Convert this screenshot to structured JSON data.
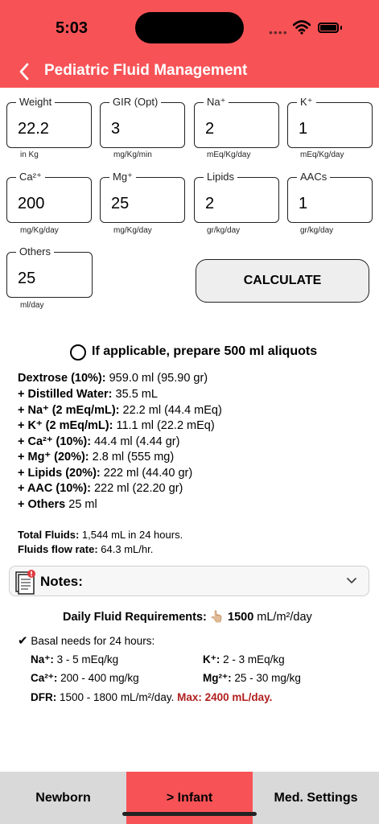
{
  "status": {
    "time": "5:03"
  },
  "header": {
    "title": "Pediatric Fluid Management"
  },
  "inputs": [
    {
      "label": "Weight",
      "value": "22.2",
      "unit": "in Kg"
    },
    {
      "label": "GIR (Opt)",
      "value": "3",
      "unit": "mg/Kg/min"
    },
    {
      "label": "Na⁺",
      "value": "2",
      "unit": "mEq/Kg/day"
    },
    {
      "label": "K⁺",
      "value": "1",
      "unit": "mEq/Kg/day"
    },
    {
      "label": "Ca²⁺",
      "value": "200",
      "unit": "mg/Kg/day"
    },
    {
      "label": "Mg⁺",
      "value": "25",
      "unit": "mg/Kg/day"
    },
    {
      "label": "Lipids",
      "value": "2",
      "unit": "gr/kg/day"
    },
    {
      "label": "AACs",
      "value": "1",
      "unit": "gr/kg/day"
    },
    {
      "label": "Others",
      "value": "25",
      "unit": "ml/day"
    }
  ],
  "calculate_label": "CALCULATE",
  "aliquot_label": "If applicable, prepare 500 ml aliquots",
  "results": [
    {
      "name": "Dextrose (10%):",
      "value": " 959.0 ml (95.90 gr)"
    },
    {
      "name": "+ Distilled Water:",
      "value": " 35.5 mL"
    },
    {
      "name": "+ Na⁺ (2 mEq/mL):",
      "value": " 22.2 ml (44.4 mEq)"
    },
    {
      "name": "+ K⁺ (2 mEq/mL):",
      "value": " 11.1 ml (22.2 mEq)"
    },
    {
      "name": "+ Ca²⁺ (10%):",
      "value": " 44.4 ml (4.44 gr)"
    },
    {
      "name": "+ Mg⁺ (20%):",
      "value": " 2.8 ml (555 mg)"
    },
    {
      "name": "+ Lipids (20%):",
      "value": " 222 ml (44.40 gr)"
    },
    {
      "name": "+ AAC (10%):",
      "value": " 222 ml (22.20 gr)"
    },
    {
      "name": "+ Others",
      "value": " 25 ml"
    }
  ],
  "totals": [
    {
      "name": "Total Fluids:",
      "value": " 1,544 mL in 24 hours."
    },
    {
      "name": "Fluids flow rate:",
      "value": " 64.3 mL/hr."
    }
  ],
  "notes": {
    "title": "Notes:",
    "daily_label": "Daily Fluid Requirements:",
    "hand_emoji": "👆🏼",
    "daily_value": "1500",
    "daily_unit": " mL/m²/day",
    "basal_label": "Basal needs for 24 hours:",
    "na_label": "Na⁺:",
    "na_value": " 3 - 5 mEq/kg",
    "k_label": "K⁺:",
    "k_value": " 2 - 3 mEq/kg",
    "ca_label": "Ca²⁺:",
    "ca_value": " 200 - 400 mg/kg",
    "mg_label": "Mg²⁺:",
    "mg_value": " 25 - 30 mg/kg",
    "dfr_label": "DFR:",
    "dfr_value": " 1500 - 1800 mL/m²/day. ",
    "dfr_max": "Max: 2400 mL/day."
  },
  "tabs": [
    {
      "label": "Newborn"
    },
    {
      "label": "> Infant"
    },
    {
      "label": "Med. Settings"
    }
  ],
  "colors": {
    "accent": "#f75357",
    "warning": "#b01e1e",
    "tabbar": "#d9d9d9"
  },
  "icons": [
    "back-chevron-icon",
    "wifi-icon",
    "battery-icon",
    "radio-icon",
    "notes-document-icon",
    "chevron-down-icon",
    "checkmark-icon"
  ]
}
